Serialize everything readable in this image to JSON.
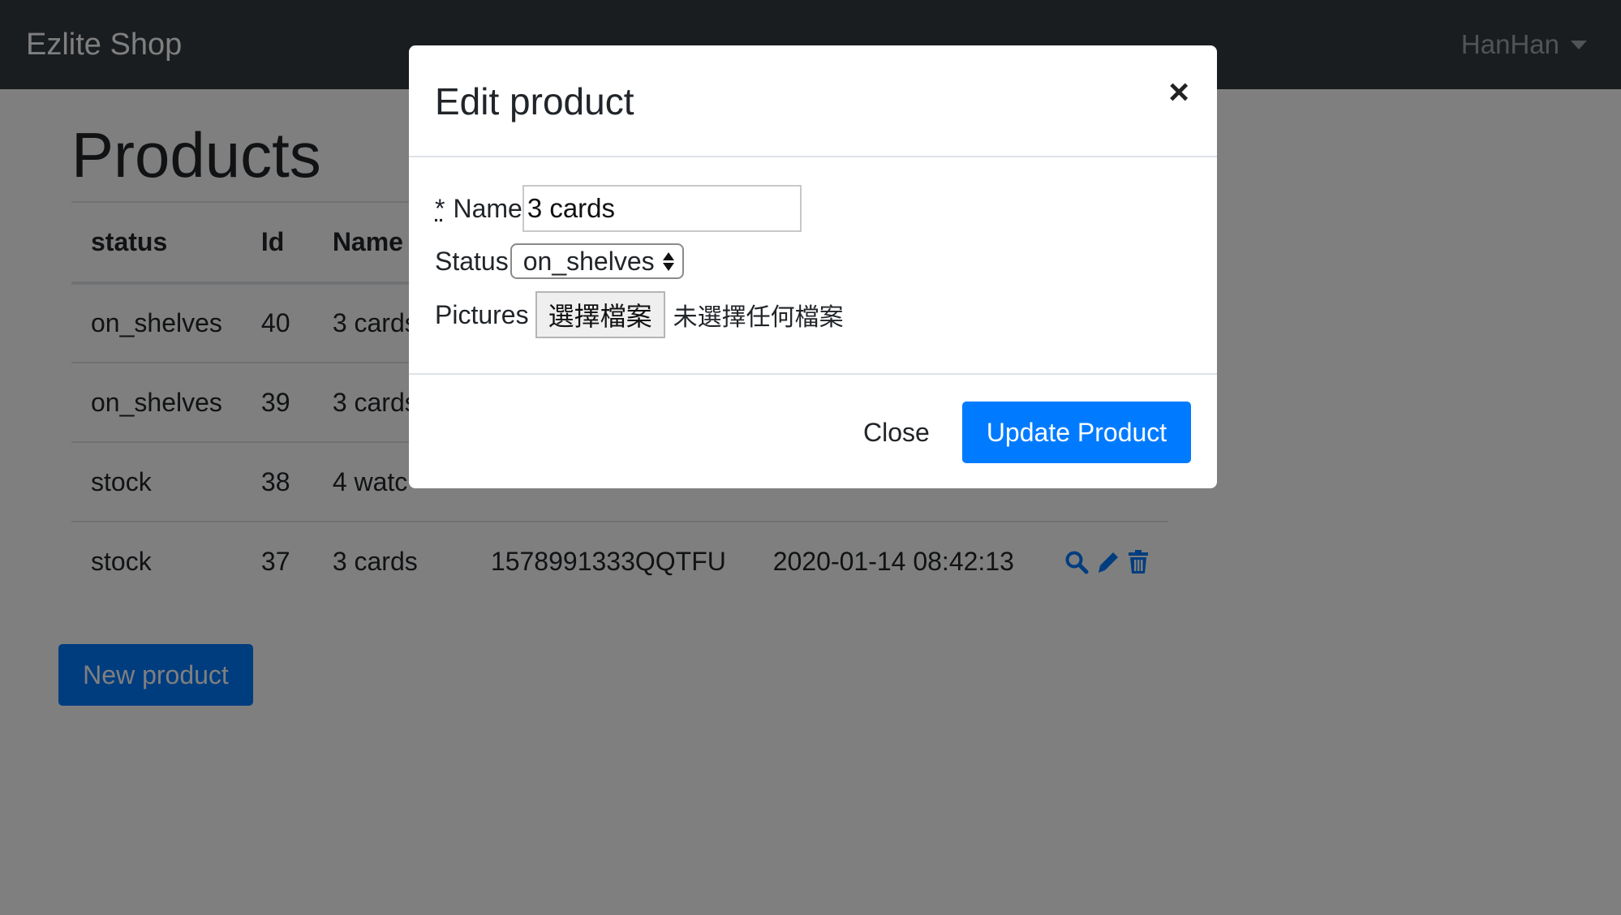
{
  "navbar": {
    "brand": "Ezlite Shop",
    "user": "HanHan"
  },
  "page": {
    "title": "Products",
    "new_button": "New product"
  },
  "table": {
    "headers": [
      "status",
      "Id",
      "Name"
    ],
    "rows": [
      {
        "status": "on_shelves",
        "id": "40",
        "name": "3 cards",
        "code": "",
        "time": ""
      },
      {
        "status": "on_shelves",
        "id": "39",
        "name": "3 cards",
        "code": "",
        "time": ""
      },
      {
        "status": "stock",
        "id": "38",
        "name": "4 watc",
        "code": "",
        "time": ""
      },
      {
        "status": "stock",
        "id": "37",
        "name": "3 cards",
        "code": "1578991333QQTFU",
        "time": "2020-01-14 08:42:13"
      }
    ]
  },
  "modal": {
    "title": "Edit product",
    "close_symbol": "×",
    "name_required_mark": "*",
    "name_label": "Name",
    "name_value": "3 cards",
    "status_label": "Status",
    "status_value": "on_shelves",
    "pictures_label": "Pictures",
    "file_button": "選擇檔案",
    "file_status": "未選擇任何檔案",
    "close_button": "Close",
    "update_button": "Update Product"
  },
  "colors": {
    "navbar": "#343a40",
    "primary": "#007bff",
    "backdrop": "rgba(0,0,0,0.5)"
  },
  "icons": [
    "search-icon",
    "pencil-icon",
    "trash-icon",
    "caret-down-icon",
    "close-icon"
  ]
}
